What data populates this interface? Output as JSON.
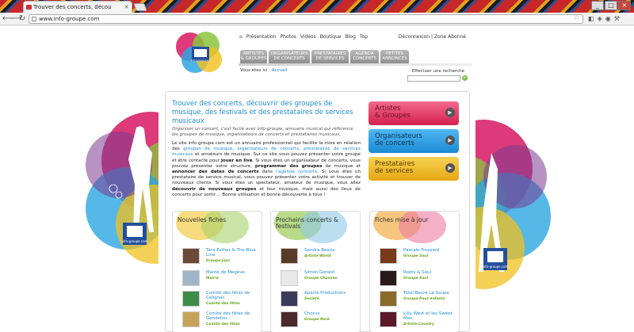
{
  "browser": {
    "tab_title": "Trouver des concerts, décou",
    "url": "www.info-groupe.com",
    "window_buttons": [
      "_",
      "□",
      "×"
    ],
    "nav_glyphs": [
      "⟵",
      "⟶",
      "↻"
    ]
  },
  "colors": {
    "accent_blue": "#1f8bd1",
    "green": "#6aa51b",
    "pink": "#d51f4e",
    "orange": "#e6a612"
  },
  "site": {
    "top_nav": [
      "Présentation",
      "Photos",
      "Vidéos",
      "Boutique",
      "Blog",
      "Top"
    ],
    "account": "Déconnexion | Zone Abonné",
    "menu": [
      {
        "l1": "ARTISTES",
        "l2": "& GROUPES"
      },
      {
        "l1": "ORGANISATEURS",
        "l2": "DE CONCERTS"
      },
      {
        "l1": "PRESTATAIRES",
        "l2": "DE SERVICES"
      },
      {
        "l1": "AGENDA",
        "l2": "CONCERTS"
      },
      {
        "l1": "PETITES",
        "l2": "ANNONCES"
      }
    ],
    "breadcrumb_prefix": "Vous êtes ici :",
    "breadcrumb_link": "Accueil",
    "search_label": "Effectuer une recherche",
    "search_placeholder": ""
  },
  "intro": {
    "title": "Trouver des concerts, découvrir des groupes de musique, des festivals et des prestataires de services musicaux",
    "subtitle": "Organiser un concert, c'est facile avec info-groupe, annuaire musical qui référence les groupes de musique, organisateurs de concerts et prestataires musicaux.",
    "p": [
      "Le site info-groupe.com est un annuaire professionnel qui facilite la mise en relation des ",
      "groupes de musique",
      ", ",
      "organisateurs de concerts",
      ", ",
      "prestataires de services musicaux",
      " et amateurs de musique. Sur ce site vous pouvez présenter votre groupe et être contacté pour ",
      "jouer en live",
      ". Si vous êtes un organisateur de concerts, vous pouvez présenter votre structure, ",
      "programmer des groupes",
      " de musique et ",
      "annoncer des dates de concerts",
      " dans ",
      "l'agenda concerts",
      ". Si vous êtes un prestataire de service musical, vous pouvez présenter votre activité et trouver de nouveaux clients. Si vous êtes un spectateur, amateur de musique, vous allez ",
      "découvrir de nouveaux groupes",
      " et leur musique, mais aussi des lieux de concerts pour sortir.... Bonne utilisation et bonne découverte à tous !"
    ]
  },
  "categories": [
    {
      "l1": "Artistes",
      "l2": "& Groupes"
    },
    {
      "l1": "Organisateurs",
      "l2": "de concerts"
    },
    {
      "l1": "Prestataires",
      "l2": "de services"
    }
  ],
  "columns": [
    {
      "title": "Nouvelles fiches",
      "items": [
        {
          "title": "Tara Esther & The Blue Line",
          "sub": "Groupe Jazz"
        },
        {
          "title": "Mairie de Megève",
          "sub": "Mairie"
        },
        {
          "title": "Comité des fêtes de Celignac",
          "sub": "Comité des fêtes"
        },
        {
          "title": "Comité des fêtes de Gandelou",
          "sub": "Comité des fêtes"
        }
      ]
    },
    {
      "title": "Prochains concerts & festivals",
      "items": [
        {
          "title": "Sandra Bessis",
          "sub": "Artiste World"
        },
        {
          "title": "Simon Genest",
          "sub": "Groupe Chanson"
        },
        {
          "title": "Aparté Productions",
          "sub": "Société"
        },
        {
          "title": "Chorus",
          "sub": "Groupe Rock"
        }
      ]
    },
    {
      "title": "Fiches mise à jour",
      "items": [
        {
          "title": "Pascale Frossard",
          "sub": "Groupe Soul"
        },
        {
          "title": "Roots & Soul",
          "sub": "Groupe Soul"
        },
        {
          "title": "Total Beurk La Soupe",
          "sub": "Groupe Pour enfants"
        },
        {
          "title": "Lilly West et les Sweet Men",
          "sub": "Artiste Country"
        }
      ]
    }
  ],
  "logo_text": "info-groupe.com"
}
